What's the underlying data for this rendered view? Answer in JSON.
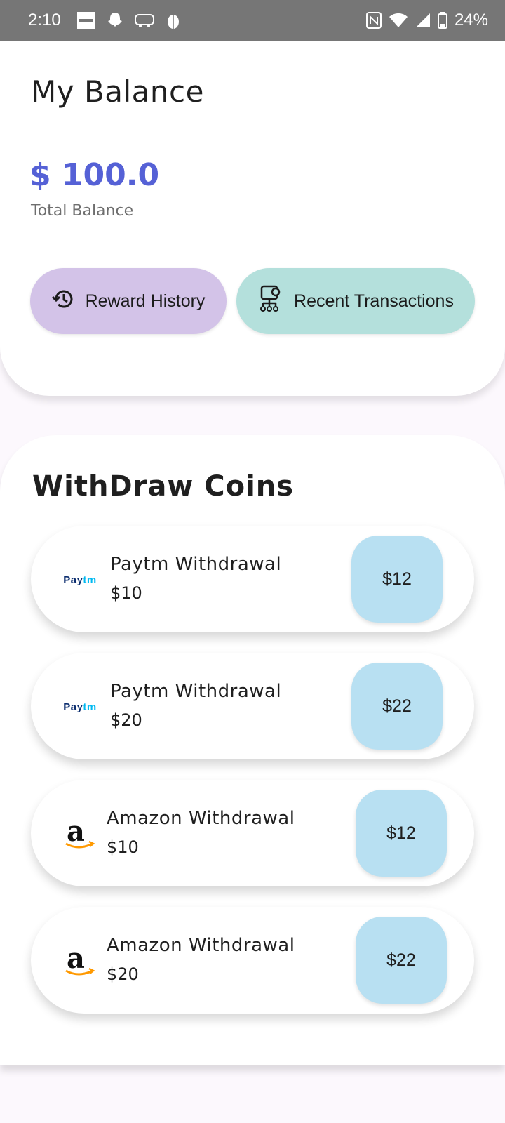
{
  "status_bar": {
    "time": "2:10",
    "battery": "24%"
  },
  "balance": {
    "title": "My Balance",
    "amount": "$ 100.0",
    "label": "Total Balance",
    "reward_history_label": "Reward History",
    "recent_transactions_label": "Recent Transactions"
  },
  "withdraw": {
    "title": "WithDraw Coins",
    "items": [
      {
        "name": "Paytm Withdrawal",
        "amount": "$10",
        "price": "$12",
        "logo": "paytm-logo"
      },
      {
        "name": "Paytm Withdrawal",
        "amount": "$20",
        "price": "$22",
        "logo": "paytm-logo"
      },
      {
        "name": "Amazon Withdrawal",
        "amount": "$10",
        "price": "$12",
        "logo": "amazon-logo"
      },
      {
        "name": "Amazon Withdrawal",
        "amount": "$20",
        "price": "$22",
        "logo": "amazon-logo"
      }
    ],
    "paytm_logo": {
      "part1": "Pay",
      "part2": "tm"
    }
  },
  "colors": {
    "accent": "#5561d6",
    "reward_pill": "#d3c3e8",
    "recent_pill": "#b4e0dc",
    "price_button": "#b8e0f2"
  }
}
